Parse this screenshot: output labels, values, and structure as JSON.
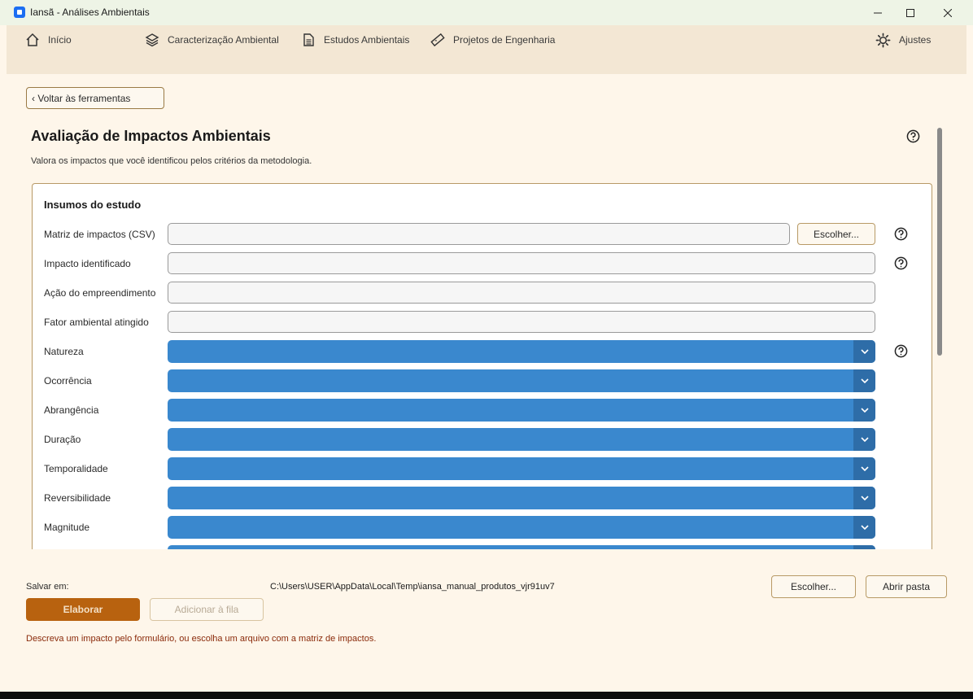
{
  "window": {
    "title": "Iansã - Análises Ambientais"
  },
  "nav": {
    "items": [
      {
        "label": "Início",
        "icon": "home-icon"
      },
      {
        "label": "Caracterização Ambiental",
        "icon": "layers-icon"
      },
      {
        "label": "Estudos Ambientais",
        "icon": "document-icon"
      },
      {
        "label": "Projetos de Engenharia",
        "icon": "ruler-icon"
      }
    ],
    "settings_label": "Ajustes"
  },
  "page": {
    "back_label": "‹ Voltar às ferramentas",
    "title": "Avaliação de Impactos Ambientais",
    "subtitle": "Valora os impactos que você identificou pelos critérios da metodologia."
  },
  "inputs": {
    "group_title": "Insumos do estudo",
    "choose_label": "Escolher...",
    "text_fields": [
      {
        "label": "Matriz de impactos (CSV)",
        "value": ""
      },
      {
        "label": "Impacto identificado",
        "value": ""
      },
      {
        "label": "Ação do empreendimento",
        "value": ""
      },
      {
        "label": "Fator ambiental atingido",
        "value": ""
      }
    ],
    "combos": [
      {
        "label": "Natureza",
        "value": ""
      },
      {
        "label": "Ocorrência",
        "value": ""
      },
      {
        "label": "Abrangência",
        "value": ""
      },
      {
        "label": "Duração",
        "value": ""
      },
      {
        "label": "Temporalidade",
        "value": ""
      },
      {
        "label": "Reversibilidade",
        "value": ""
      },
      {
        "label": "Magnitude",
        "value": ""
      }
    ]
  },
  "footer": {
    "save_label": "Salvar em:",
    "save_path": "C:\\Users\\USER\\AppData\\Local\\Temp\\iansa_manual_produtos_vjr91uv7",
    "choose_label": "Escolher...",
    "open_folder_label": "Abrir pasta",
    "run_label": "Elaborar",
    "queue_label": "Adicionar à fila",
    "status": "Descreva um impacto pelo formulário, ou escolha um arquivo com a matriz de impactos."
  },
  "colors": {
    "accent": "#b8620f",
    "combo": "#3a88ce",
    "status_text": "#8a2a0a"
  }
}
